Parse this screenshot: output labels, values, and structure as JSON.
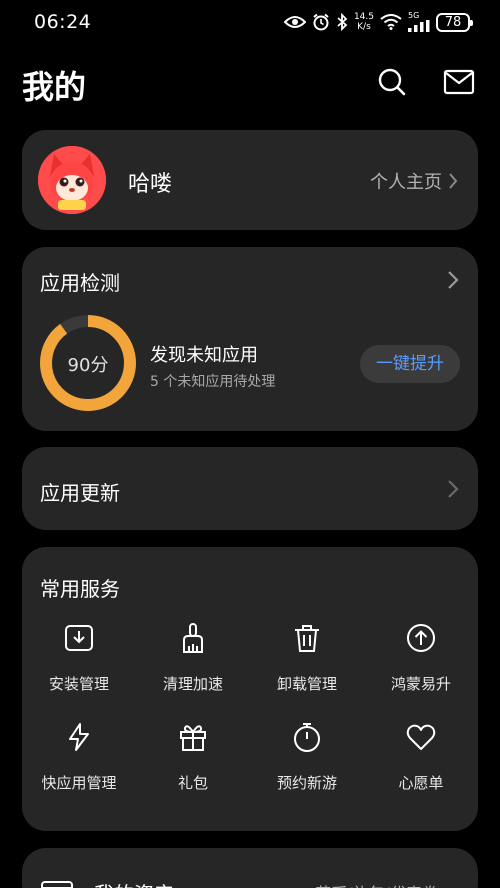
{
  "status_bar": {
    "time": "06:24",
    "net_speed_value": "14.5",
    "net_speed_unit": "K/s",
    "network_type": "5G",
    "battery": "78"
  },
  "header": {
    "title": "我的",
    "icons": [
      "search-icon",
      "mail-icon"
    ]
  },
  "profile": {
    "name": "哈喽",
    "home_link": "个人主页"
  },
  "app_check": {
    "title": "应用检测",
    "score": "90分",
    "score_fraction": 0.9,
    "headline": "发现未知应用",
    "subtitle": "5 个未知应用待处理",
    "action": "一键提升",
    "colors": {
      "ring": "#f2a53a",
      "action_text": "#5a9bff"
    }
  },
  "app_update": {
    "title": "应用更新"
  },
  "services": {
    "title": "常用服务",
    "items": [
      {
        "label": "安装管理",
        "icon": "install-icon"
      },
      {
        "label": "清理加速",
        "icon": "broom-icon"
      },
      {
        "label": "卸载管理",
        "icon": "trash-icon"
      },
      {
        "label": "鸿蒙易升",
        "icon": "upgrade-icon"
      },
      {
        "label": "快应用管理",
        "icon": "lightning-icon"
      },
      {
        "label": "礼包",
        "icon": "gift-icon"
      },
      {
        "label": "预约新游",
        "icon": "stopwatch-icon"
      },
      {
        "label": "心愿单",
        "icon": "heart-icon"
      }
    ]
  },
  "assets": {
    "title": "我的资产",
    "subtitle": "花币/礼包/代表券"
  }
}
